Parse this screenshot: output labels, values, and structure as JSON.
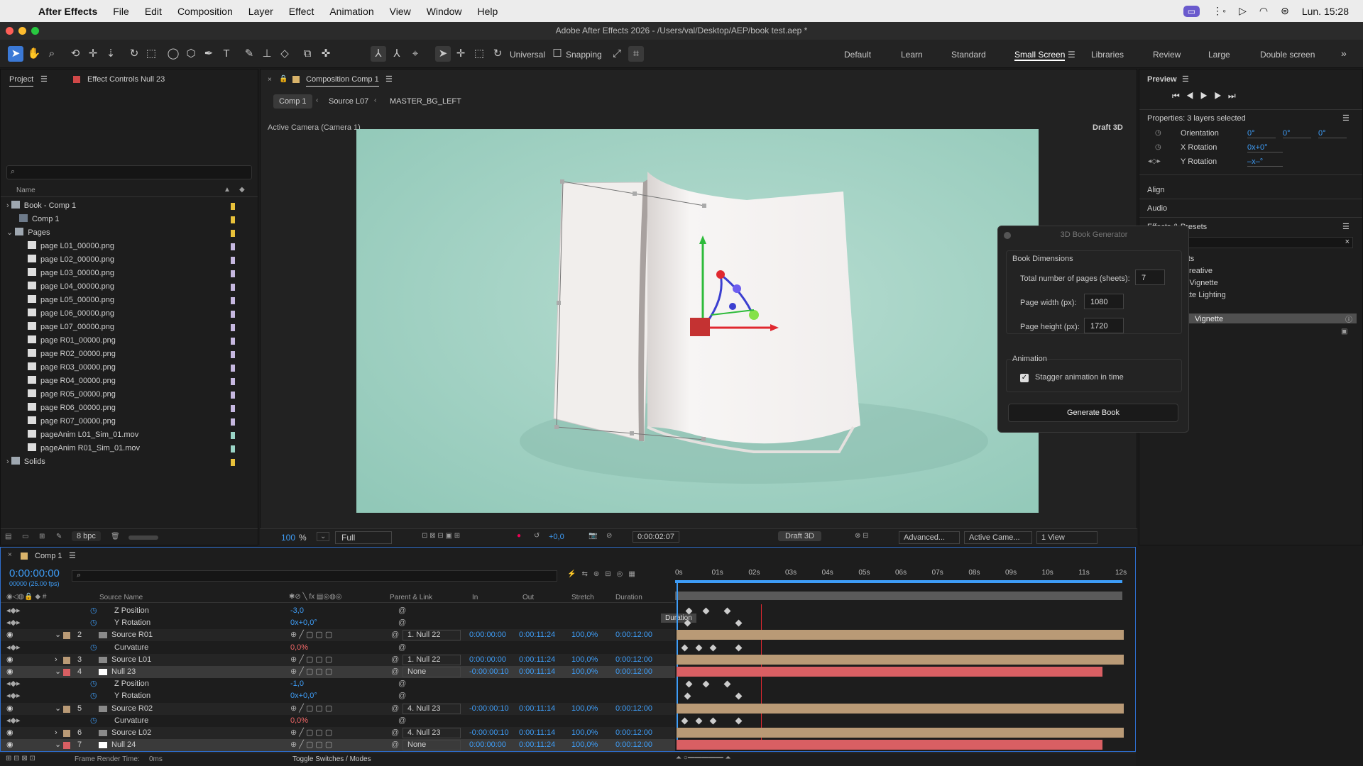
{
  "menubar": {
    "app": "After Effects",
    "items": [
      "File",
      "Edit",
      "Composition",
      "Layer",
      "Effect",
      "Animation",
      "View",
      "Window",
      "Help"
    ],
    "clock": "Lun. 15:28"
  },
  "window": {
    "title": "Adobe After Effects 2026 - /Users/val/Desktop/AEP/book test.aep *"
  },
  "toolbar": {
    "universal": "Universal",
    "snapping": "Snapping",
    "workspaces": [
      "Default",
      "Learn",
      "Standard",
      "Small Screen",
      "Libraries",
      "Review",
      "Large",
      "Double screen"
    ],
    "active_workspace": "Small Screen"
  },
  "project": {
    "tab": "Project",
    "effect_tab": "Effect Controls Null 23",
    "search_placeholder": "",
    "col_name": "Name",
    "items": [
      {
        "label": "Book - Comp 1",
        "type": "folder",
        "color": "#e8c13a"
      },
      {
        "label": "Comp 1",
        "type": "comp",
        "color": "#e8c13a"
      },
      {
        "label": "Pages",
        "type": "folder",
        "color": "#e8c13a"
      },
      {
        "label": "page L01_00000.png",
        "type": "file",
        "color": "#c6b8e0"
      },
      {
        "label": "page L02_00000.png",
        "type": "file",
        "color": "#c6b8e0"
      },
      {
        "label": "page L03_00000.png",
        "type": "file",
        "color": "#c6b8e0"
      },
      {
        "label": "page L04_00000.png",
        "type": "file",
        "color": "#c6b8e0"
      },
      {
        "label": "page L05_00000.png",
        "type": "file",
        "color": "#c6b8e0"
      },
      {
        "label": "page L06_00000.png",
        "type": "file",
        "color": "#c6b8e0"
      },
      {
        "label": "page L07_00000.png",
        "type": "file",
        "color": "#c6b8e0"
      },
      {
        "label": "page R01_00000.png",
        "type": "file",
        "color": "#c6b8e0"
      },
      {
        "label": "page R02_00000.png",
        "type": "file",
        "color": "#c6b8e0"
      },
      {
        "label": "page R03_00000.png",
        "type": "file",
        "color": "#c6b8e0"
      },
      {
        "label": "page R04_00000.png",
        "type": "file",
        "color": "#c6b8e0"
      },
      {
        "label": "page R05_00000.png",
        "type": "file",
        "color": "#c6b8e0"
      },
      {
        "label": "page R06_00000.png",
        "type": "file",
        "color": "#c6b8e0"
      },
      {
        "label": "page R07_00000.png",
        "type": "file",
        "color": "#c6b8e0"
      },
      {
        "label": "pageAnim L01_Sim_01.mov",
        "type": "file",
        "color": "#9ad4c6"
      },
      {
        "label": "pageAnim R01_Sim_01.mov",
        "type": "file",
        "color": "#9ad4c6"
      },
      {
        "label": "Solids",
        "type": "folder",
        "color": "#e8c13a"
      }
    ],
    "bpc": "8 bpc"
  },
  "comp": {
    "tab": "Composition Comp 1",
    "breadcrumbs": [
      "Comp 1",
      "Source L07",
      "MASTER_BG_LEFT"
    ],
    "camera": "Active Camera (Camera 1)",
    "renderer": "Draft 3D",
    "footer": {
      "zoom": "100",
      "zoom_unit": "%",
      "quality": "Full",
      "exposure": "+0,0",
      "time": "0:00:02:07",
      "draft": "Draft 3D",
      "advanced": "Advanced...",
      "camera": "Active Came...",
      "views": "1 View"
    }
  },
  "preview": {
    "title": "Preview"
  },
  "properties": {
    "title": "Properties: 3 layers selected",
    "rows": [
      {
        "label": "Orientation",
        "v1": "0°",
        "v2": "0°",
        "v3": "0°"
      },
      {
        "label": "X Rotation",
        "v1": "0x+0°"
      },
      {
        "label": "Y Rotation",
        "v1": "–x–°"
      }
    ],
    "align": "Align",
    "audio": "Audio",
    "effects_title": "Effects & Presets",
    "effects": [
      "Presets",
      "ge - Creative",
      "Noisy Vignette",
      "Vignette Lighting"
    ],
    "selected_effect": "Vignette"
  },
  "dialog": {
    "title": "3D Book Generator",
    "sec1": "Book Dimensions",
    "pages_label": "Total number of pages (sheets):",
    "pages_val": "7",
    "width_label": "Page width (px):",
    "width_val": "1080",
    "height_label": "Page height (px):",
    "height_val": "1720",
    "sec2": "Animation",
    "stagger": "Stagger animation in time",
    "generate": "Generate Book"
  },
  "timeline": {
    "tab": "Comp 1",
    "time": "0:00:00:00",
    "fps": "00000 (25.00 fps)",
    "cols": {
      "name": "Source Name",
      "parent": "Parent & Link",
      "in": "In",
      "out": "Out",
      "stretch": "Stretch",
      "duration": "Duration"
    },
    "ticks": [
      "0s",
      "01s",
      "02s",
      "03s",
      "04s",
      "05s",
      "06s",
      "07s",
      "08s",
      "09s",
      "10s",
      "11s",
      "12s"
    ],
    "tooltip": "Duration",
    "rows": [
      {
        "kind": "prop",
        "name": "Z Position",
        "value": "-3,0"
      },
      {
        "kind": "prop",
        "name": "Y Rotation",
        "value": "0x+0,0°"
      },
      {
        "kind": "layer",
        "num": "2",
        "name": "Source R01",
        "parent": "1. Null 22",
        "in": "0:00:00:00",
        "out": "0:00:11:24",
        "stretch": "100,0%",
        "dur": "0:00:12:00",
        "color": "#b99a76"
      },
      {
        "kind": "prop",
        "name": "Curvature",
        "value": "0,0%"
      },
      {
        "kind": "layer",
        "num": "3",
        "name": "Source L01",
        "parent": "1. Null 22",
        "in": "0:00:00:00",
        "out": "0:00:11:24",
        "stretch": "100,0%",
        "dur": "0:00:12:00",
        "color": "#b99a76"
      },
      {
        "kind": "layer",
        "num": "4",
        "name": "Null 23",
        "parent": "None",
        "in": "-0:00:00:10",
        "out": "0:00:11:14",
        "stretch": "100,0%",
        "dur": "0:00:12:00",
        "color": "#d95f63"
      },
      {
        "kind": "prop",
        "name": "Z Position",
        "value": "-1,0"
      },
      {
        "kind": "prop",
        "name": "Y Rotation",
        "value": "0x+0,0°"
      },
      {
        "kind": "layer",
        "num": "5",
        "name": "Source R02",
        "parent": "4. Null 23",
        "in": "-0:00:00:10",
        "out": "0:00:11:14",
        "stretch": "100,0%",
        "dur": "0:00:12:00",
        "color": "#b99a76"
      },
      {
        "kind": "prop",
        "name": "Curvature",
        "value": "0,0%"
      },
      {
        "kind": "layer",
        "num": "6",
        "name": "Source L02",
        "parent": "4. Null 23",
        "in": "-0:00:00:10",
        "out": "0:00:11:14",
        "stretch": "100,0%",
        "dur": "0:00:12:00",
        "color": "#b99a76"
      },
      {
        "kind": "layer",
        "num": "7",
        "name": "Null 24",
        "parent": "None",
        "in": "0:00:00:00",
        "out": "0:00:11:24",
        "stretch": "100,0%",
        "dur": "0:00:12:00",
        "color": "#d95f63"
      }
    ],
    "footer_render": "Frame Render Time:",
    "footer_ms": "0ms",
    "toggle": "Toggle Switches / Modes"
  }
}
